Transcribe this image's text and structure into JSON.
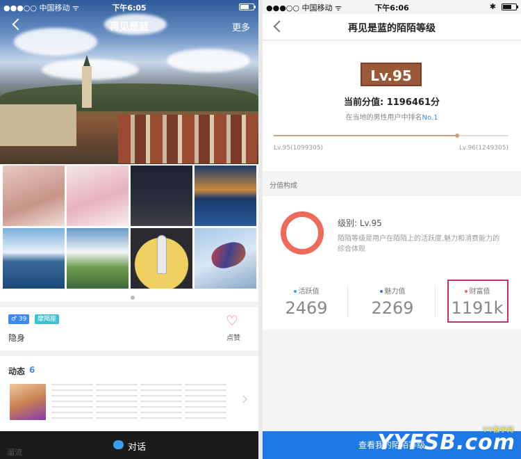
{
  "left": {
    "status": {
      "carrier": "●●●○○ 中国移动 ᯤ",
      "time": "下午6:05"
    },
    "nav": {
      "title": "再见是蓝",
      "more": "更多"
    },
    "profile": {
      "gender_badge": "♂ 39",
      "sign_badge": "摩羯座",
      "visibility": "隐身",
      "like_label": "点赞"
    },
    "dynamics": {
      "title": "动态",
      "count": "6"
    },
    "chat_label": "对话",
    "bottom_faint": "溜流"
  },
  "right": {
    "status": {
      "carrier": "●●●○○ 中国移动 ᯤ",
      "time": "下午6:06"
    },
    "nav": {
      "title": "再见是蓝的陌陌等级"
    },
    "level": {
      "badge": "Lv.95",
      "score_text": "当前分值: 1196461分",
      "rank_prefix": "在当地的男性用户中排名",
      "rank_value": "No.1",
      "progress": 0.78,
      "left_label": "Lv.95(1099305)",
      "right_label": "Lv.96(1249305)"
    },
    "composition": {
      "section_title": "分值构成",
      "level_text": "级别: Lv.95",
      "description": "陌陌等级是用户在陌陌上的活跃度,魅力和消费能力的综合体现",
      "stats": [
        {
          "label": "活跃值",
          "value": "2469",
          "dot_color": "#2aa6e0"
        },
        {
          "label": "魅力值",
          "value": "2269",
          "dot_color": "#3d6ae0"
        },
        {
          "label": "财富值",
          "value": "1191k",
          "dot_color": "#ee6a5a"
        }
      ],
      "ring_color": "#ee6a5a"
    },
    "cta_label": "查看我的陌陌等级",
    "watermark": "YYFSB.com",
    "watermark_sub": "YY教手网"
  }
}
